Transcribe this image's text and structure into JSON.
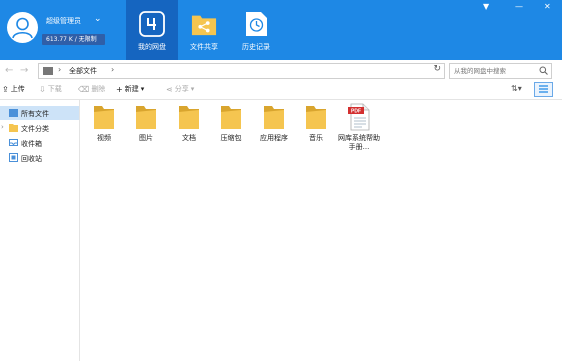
{
  "user": {
    "name": "超级管理员",
    "quota": "613.77 K / 无限制"
  },
  "nav": [
    {
      "label": "我的网盘"
    },
    {
      "label": "文件共享"
    },
    {
      "label": "历史记录"
    }
  ],
  "window_controls": {
    "menu": "▼",
    "minimize": "—",
    "close": "✕"
  },
  "address": {
    "path": "全部文件",
    "search_placeholder": "从我的网盘中搜索"
  },
  "toolbar": {
    "upload": "上传",
    "download": "下载",
    "delete": "删除",
    "new": "新建",
    "share": "分享"
  },
  "sidebar": [
    {
      "label": "所有文件"
    },
    {
      "label": "文件分类"
    },
    {
      "label": "收件箱"
    },
    {
      "label": "回收站"
    }
  ],
  "files": [
    {
      "name": "视频"
    },
    {
      "name": "图片"
    },
    {
      "name": "文档"
    },
    {
      "name": "压缩包"
    },
    {
      "name": "应用程序"
    },
    {
      "name": "音乐"
    },
    {
      "name": "网库系统帮助手册...",
      "badge": "PDF"
    }
  ],
  "colors": {
    "header": "#1e88e5",
    "nav_active": "#1565c0",
    "folder": "#f5c550",
    "sidebar_active": "#cde3f8"
  }
}
